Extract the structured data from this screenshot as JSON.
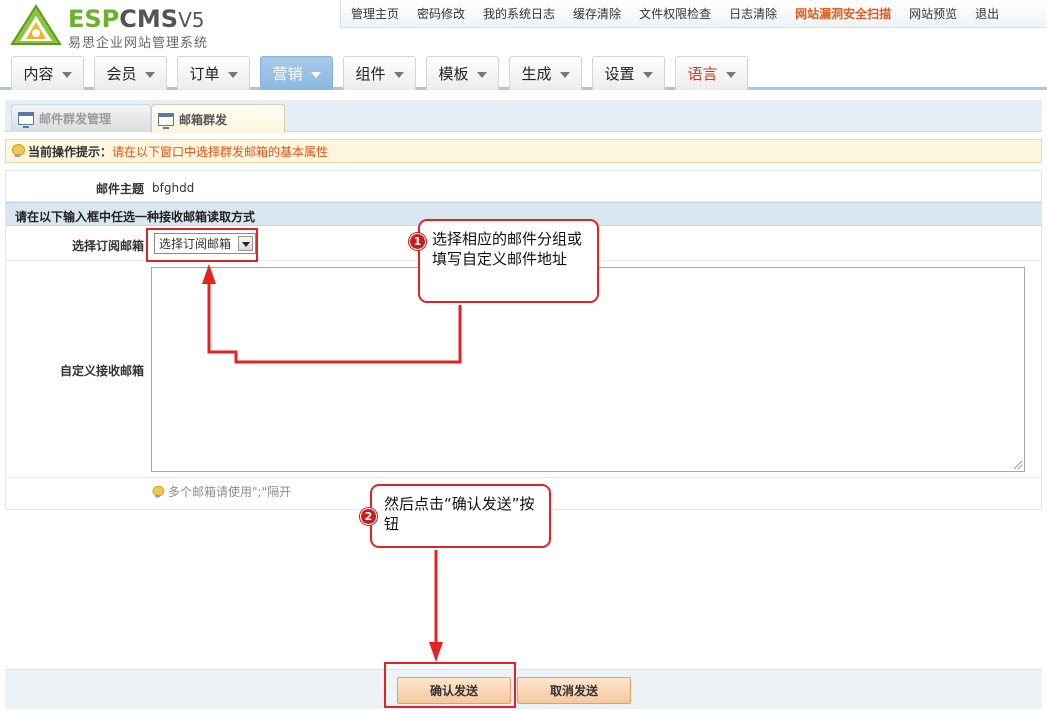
{
  "logo": {
    "title_esp": "ESP",
    "title_cms": "CMS",
    "title_ver": "V5",
    "subtitle": "易思企业网站管理系统"
  },
  "toplinks": [
    "管理主页",
    "密码修改",
    "我的系统日志",
    "缓存清除",
    "文件权限检查",
    "日志清除",
    "网站漏洞安全扫描",
    "网站预览",
    "退出"
  ],
  "nav": [
    "内容",
    "会员",
    "订单",
    "营销",
    "组件",
    "模板",
    "生成",
    "设置",
    "语言"
  ],
  "subtabs": {
    "mass_mail_manage": "邮件群发管理",
    "mailbox_send": "邮箱群发"
  },
  "tip": {
    "label": "当前操作提示：",
    "text": "请在以下窗口中选择群发邮箱的基本属性"
  },
  "form": {
    "subject_label": "邮件主题",
    "subject_value": "bfghdd",
    "section_title": "请在以下输入框中任选一种接收邮箱读取方式",
    "select_label": "选择订阅邮箱",
    "select_value": "选择订阅邮箱",
    "custom_label": "自定义接收邮箱",
    "custom_value": "",
    "hint": "多个邮箱请使用\";\"隔开"
  },
  "buttons": {
    "confirm": "确认发送",
    "cancel": "取消发送"
  },
  "annotations": {
    "step1_num": "1",
    "step1_text": "选择相应的邮件分组或填写自定义邮件地址",
    "step2_num": "2",
    "step2_text": "然后点击“确认发送”按钮"
  },
  "colors": {
    "accent_red": "#e02424",
    "nav_active": "#8ab8df",
    "tip_text": "#e4531d",
    "hot_link": "#e35a1a"
  }
}
